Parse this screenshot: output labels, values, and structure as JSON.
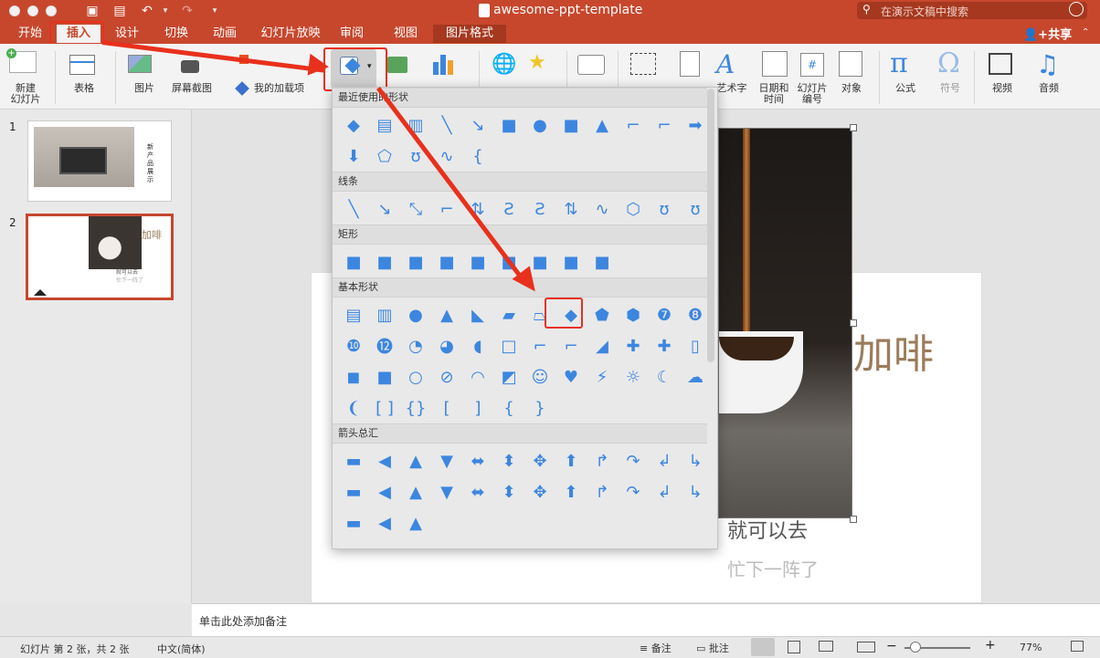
{
  "window": {
    "title": "awesome-ppt-template",
    "search_placeholder": "在演示文稿中搜索",
    "share": "共享"
  },
  "tabs": [
    "开始",
    "插入",
    "设计",
    "切换",
    "动画",
    "幻灯片放映",
    "审阅",
    "视图",
    "图片格式"
  ],
  "ribbon": {
    "new_slide": "新建\n幻灯片",
    "table": "表格",
    "picture": "图片",
    "screenshot": "屏幕截图",
    "addins": "我的加载项",
    "wordart": "艺术字",
    "datetime": "日期和\n时间",
    "slide_number": "幻灯片\n编号",
    "object": "对象",
    "equation": "公式",
    "symbol": "符号",
    "video": "视频",
    "audio": "音频"
  },
  "shapes_panel": {
    "sections": [
      "最近使用的形状",
      "线条",
      "矩形",
      "基本形状",
      "箭头总汇"
    ]
  },
  "slides": [
    {
      "num": "1",
      "text": "新\n产\n品\n展\n示"
    },
    {
      "num": "2",
      "title": "加啡",
      "line1": "就可以去",
      "line2": "忙下一阵了"
    }
  ],
  "slide_main": {
    "title": "加啡",
    "line1": "就可以去",
    "line2": "忙下一阵了"
  },
  "notes_placeholder": "单击此处添加备注",
  "status": {
    "slide_info": "幻灯片 第 2 张，共 2 张",
    "language": "中文(简体)",
    "notes": "备注",
    "comments": "批注",
    "zoom": "77%"
  },
  "colors": {
    "accent": "#c7472d",
    "shape": "#3d86df",
    "red": "#e8301c",
    "coffee": "#9b7c5c"
  }
}
